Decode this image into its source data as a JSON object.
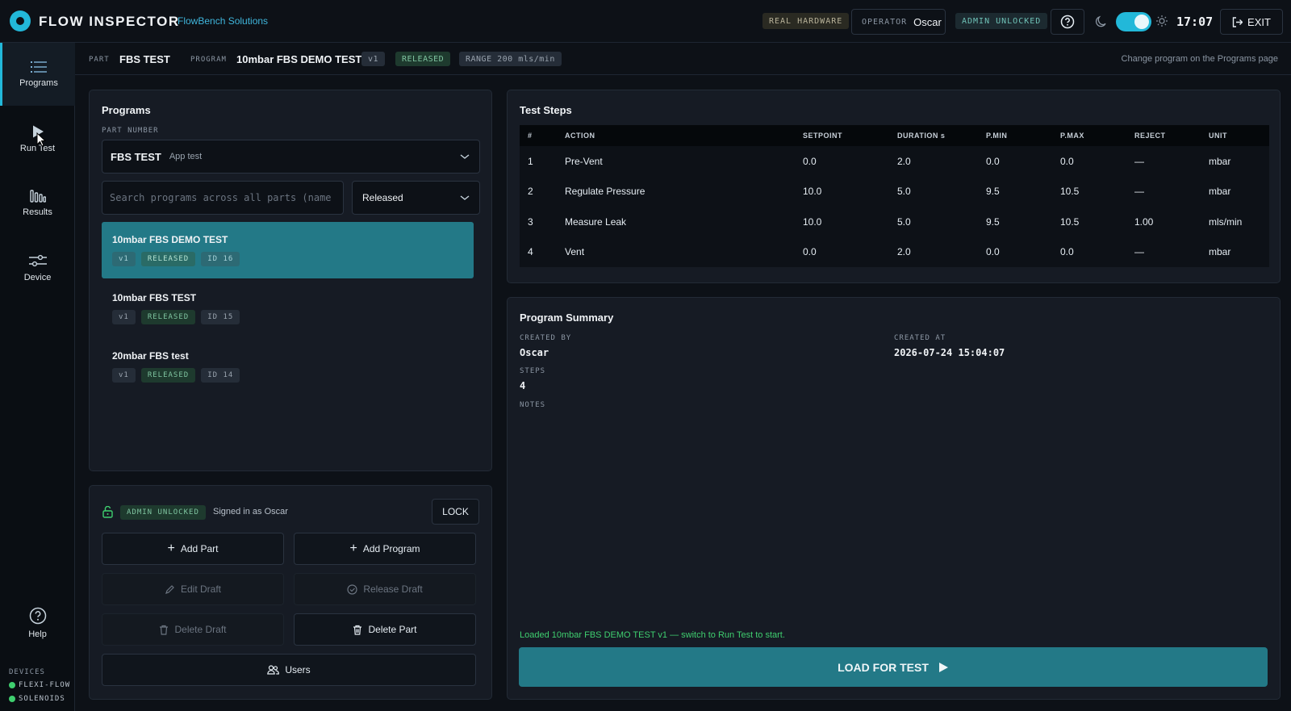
{
  "header": {
    "title": "FLOW INSPECTOR",
    "company": "FlowBench Solutions",
    "hardware_badge": "REAL HARDWARE",
    "operator_label": "OPERATOR",
    "operator_name": "Oscar",
    "admin_badge": "ADMIN UNLOCKED",
    "time": "17:07",
    "exit_label": "EXIT"
  },
  "sidebar": {
    "items": [
      {
        "label": "Programs",
        "icon": "list-icon",
        "active": true
      },
      {
        "label": "Run Test",
        "icon": "play-icon",
        "active": false
      },
      {
        "label": "Results",
        "icon": "bar-chart-icon",
        "active": false
      },
      {
        "label": "Device",
        "icon": "sliders-icon",
        "active": false
      }
    ],
    "help_label": "Help",
    "devices_title": "DEVICES",
    "devices": [
      "FLEXI-FLOW",
      "SOLENOIDS"
    ]
  },
  "subheader": {
    "part_label": "PART",
    "part_value": "FBS TEST",
    "program_label": "PROGRAM",
    "program_value": "10mbar FBS DEMO TEST",
    "version": "v1",
    "status": "RELEASED",
    "range": "RANGE 200 mls/min",
    "hint": "Change program on the Programs page"
  },
  "programs": {
    "title": "Programs",
    "part_number_label": "PART NUMBER",
    "part_selected": "FBS TEST",
    "part_sub": "App test",
    "search_placeholder": "Search programs across all parts (name",
    "filter_value": "Released",
    "list": [
      {
        "name": "10mbar FBS DEMO TEST",
        "version": "v1",
        "status": "RELEASED",
        "id": "ID 16"
      },
      {
        "name": "10mbar FBS TEST",
        "version": "v1",
        "status": "RELEASED",
        "id": "ID 15"
      },
      {
        "name": "20mbar FBS test",
        "version": "v1",
        "status": "RELEASED",
        "id": "ID 14"
      }
    ]
  },
  "admin": {
    "badge": "ADMIN UNLOCKED",
    "signed_in": "Signed in as Oscar",
    "lock_label": "LOCK",
    "add_part": "Add Part",
    "add_program": "Add Program",
    "edit_draft": "Edit Draft",
    "release_draft": "Release Draft",
    "delete_draft": "Delete Draft",
    "delete_part": "Delete Part",
    "users": "Users"
  },
  "steps": {
    "title": "Test Steps",
    "columns": [
      "#",
      "ACTION",
      "SETPOINT",
      "DURATION s",
      "P.MIN",
      "P.MAX",
      "REJECT",
      "UNIT"
    ],
    "rows": [
      [
        "1",
        "Pre-Vent",
        "0.0",
        "2.0",
        "0.0",
        "0.0",
        "—",
        "mbar"
      ],
      [
        "2",
        "Regulate Pressure",
        "10.0",
        "5.0",
        "9.5",
        "10.5",
        "—",
        "mbar"
      ],
      [
        "3",
        "Measure Leak",
        "10.0",
        "5.0",
        "9.5",
        "10.5",
        "1.00",
        "mls/min"
      ],
      [
        "4",
        "Vent",
        "0.0",
        "2.0",
        "0.0",
        "0.0",
        "—",
        "mbar"
      ]
    ]
  },
  "summary": {
    "title": "Program Summary",
    "created_by_label": "CREATED BY",
    "created_by": "Oscar",
    "created_at_label": "CREATED AT",
    "created_at": "2026-07-24 15:04:07",
    "steps_label": "STEPS",
    "steps": "4",
    "notes_label": "NOTES",
    "status_message": "Loaded 10mbar FBS DEMO TEST v1 — switch to Run Test to start.",
    "load_label": "LOAD FOR TEST"
  },
  "colors": {
    "accent": "#22b8d9",
    "selected": "#237987",
    "success": "#3fcf6f"
  }
}
